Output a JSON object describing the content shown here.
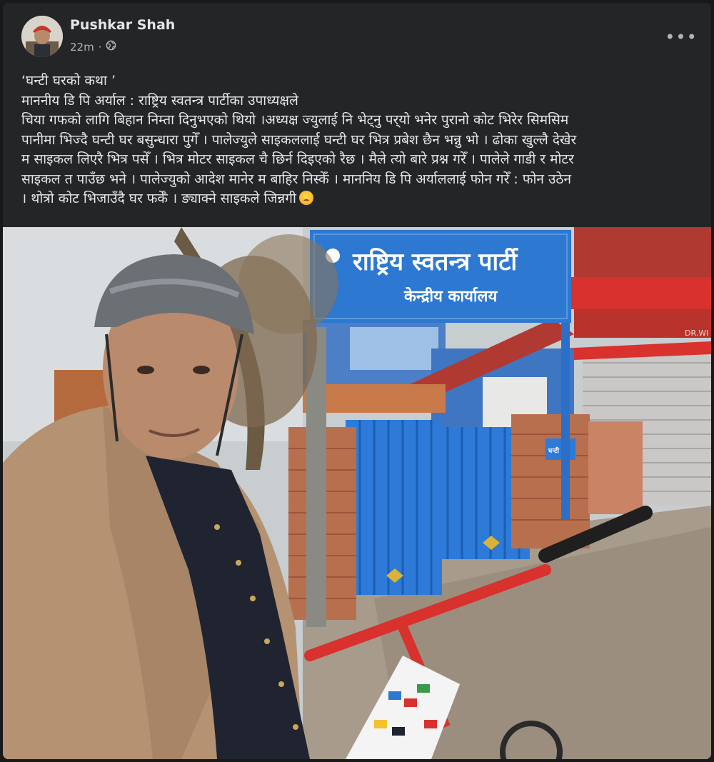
{
  "post": {
    "author": "Pushkar Shah",
    "time": "22m",
    "privacy_icon": "globe-icon",
    "more_icon": "more-options-icon",
    "text_lines": [
      "‘घन्टी घरको कथा ’",
      "माननीय डि पि अर्याल : राष्ट्रिय स्वतन्त्र पार्टीका उपाध्यक्षले",
      "चिया गफको लागि बिहान निम्ता दिनुभएको थियो ।अध्यक्ष ज्युलाई नि भेट्नु पर्‌यो भनेर पुरानो कोट भिरेर सिमसिम",
      "पानीमा भिज्दै घन्टी घर बसुन्धारा पुगेँ । पालेज्युले साइकललाई घन्टी घर भित्र प्रबेश छैन भन्नु भो । ढोका खुल्लै देखेर",
      "म साइकल लिएरै भित्र पसेँ । भित्र मोटर साइकल चै छिर्न दिइएको रैछ । मैले त्यो बारे प्रश्न गरेँ । पालेले गाडी र मोटर",
      "साइकल त पाउँछ भने । पालेज्युको आदेश मानेर म बाहिर निस्केँ । माननिय डि पि अर्याललाई फोन गरेँ : फोन उठेन",
      "। थोत्रो कोट भिजाउँदै घर फर्केँ । ङ्याक्ने साइकले जिन्नगी"
    ],
    "emoji": "crying-face"
  },
  "photo": {
    "sign_title": "राष्ट्रिय स्वतन्त्र पार्टी",
    "sign_subtitle": "केन्द्रीय कार्यालय",
    "small_sign": "घन्टी घर",
    "shop_sign": "DR.WI"
  }
}
